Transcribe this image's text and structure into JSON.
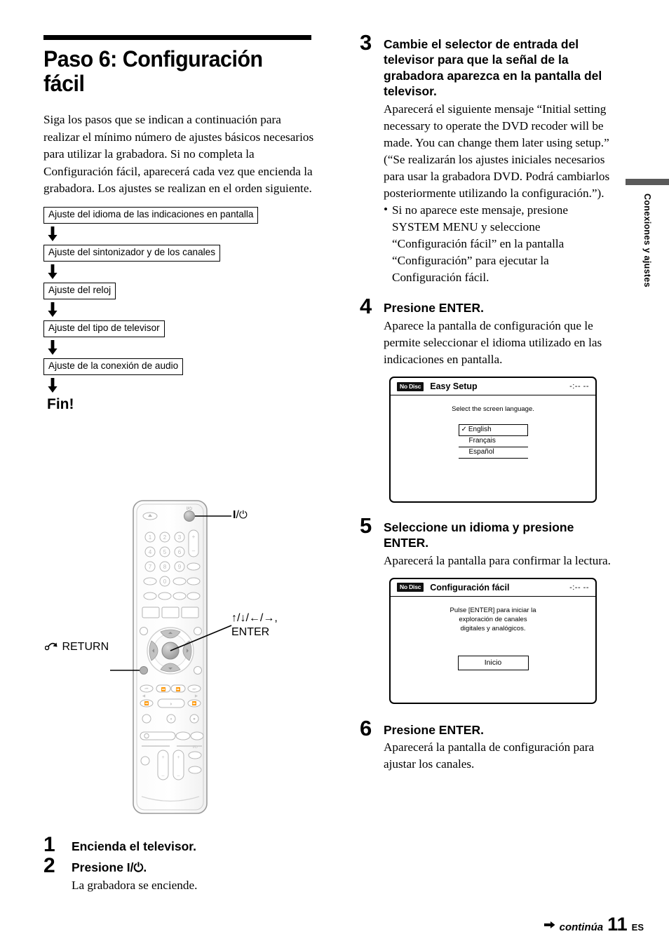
{
  "page_title": "Paso 6: Configuración fácil",
  "intro": "Siga los pasos que se indican a continuación para realizar el mínimo número de ajustes básicos necesarios para utilizar la grabadora. Si no completa la Configuración fácil, aparecerá cada vez que encienda la grabadora.\nLos ajustes se realizan en el orden siguiente.",
  "flow": {
    "boxes": [
      "Ajuste del idioma de las indicaciones en pantalla",
      "Ajuste del sintonizador y de los canales",
      "Ajuste del reloj",
      "Ajuste del tipo de televisor",
      "Ajuste de la conexión de audio"
    ],
    "end_label": "Fin!"
  },
  "remote": {
    "callouts": {
      "power": "⏻",
      "power_label": "I/⏻",
      "dpad": "↑/↓/←/→,",
      "dpad_line2": "ENTER",
      "return": "RETURN"
    }
  },
  "steps_left": [
    {
      "num": "1",
      "head": "Encienda el televisor.",
      "body": ""
    },
    {
      "num": "2",
      "head": "Presione I/⏻.",
      "body": "La grabadora se enciende."
    }
  ],
  "steps_right": [
    {
      "num": "3",
      "head": "Cambie el selector de entrada del televisor para que la señal de la grabadora aparezca en la pantalla del televisor.",
      "body": "Aparecerá el siguiente mensaje “Initial setting necessary to operate the DVD recoder will be made. You can change them later using setup.” (“Se realizarán los ajustes iniciales necesarios para usar la grabadora DVD. Podrá cambiarlos posteriormente utilizando la configuración.”).",
      "bullets": [
        "Si no aparece este mensaje, presione SYSTEM MENU y seleccione “Configuración fácil” en la pantalla “Configuración” para ejecutar la Configuración fácil."
      ]
    },
    {
      "num": "4",
      "head": "Presione ENTER.",
      "body": "Aparece la pantalla de configuración que le permite seleccionar el idioma utilizado en las indicaciones en pantalla."
    },
    {
      "num": "5",
      "head": "Seleccione un idioma y presione ENTER.",
      "body": "Aparecerá la pantalla para confirmar la lectura."
    },
    {
      "num": "6",
      "head": "Presione ENTER.",
      "body": "Aparecerá la pantalla de configuración para ajustar los canales."
    }
  ],
  "screen1": {
    "disc_badge": "No Disc",
    "title": "Easy Setup",
    "clock": "-:-- --",
    "prompt": "Select the screen language.",
    "check": "✓",
    "languages": [
      {
        "label": "English",
        "selected": true
      },
      {
        "label": "Français",
        "selected": false
      },
      {
        "label": "Español",
        "selected": false
      }
    ]
  },
  "screen2": {
    "disc_badge": "No Disc",
    "title": "Configuración fácil",
    "clock": "-:-- --",
    "prompt": "Pulse [ENTER] para iniciar la\nexploración de canales\ndigitales y analógicos.",
    "button": "Inicio"
  },
  "side_tab": {
    "label": "Conexiones y ajustes",
    "bar_color": "#5a5a5a"
  },
  "footer": {
    "continue": "continúa",
    "page": "11",
    "lang": "ES"
  }
}
